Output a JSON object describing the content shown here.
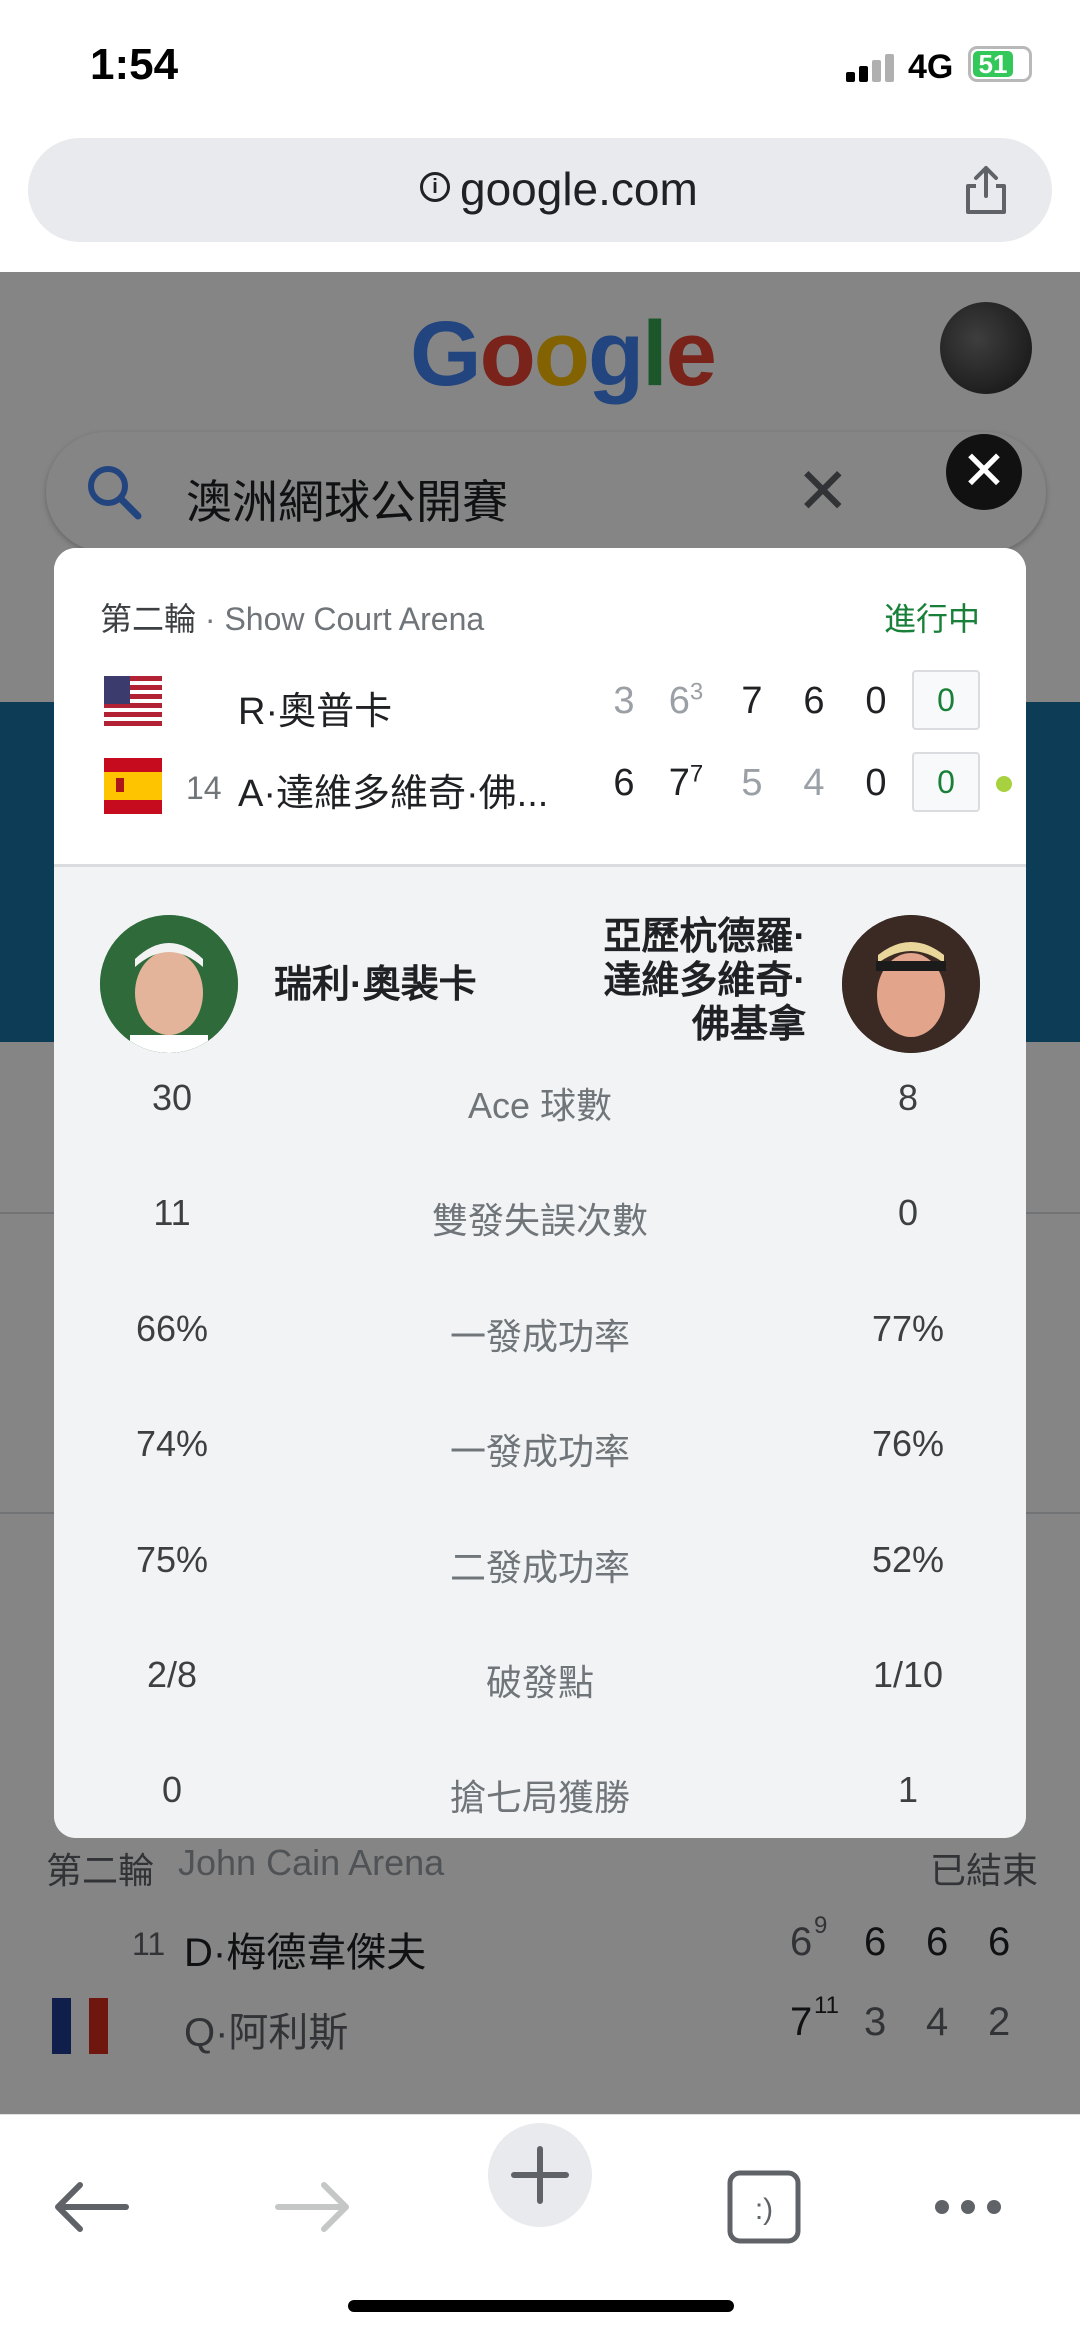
{
  "status_bar": {
    "time": "1:54",
    "network": "4G",
    "battery": "51"
  },
  "browser": {
    "url": "google.com"
  },
  "background_page": {
    "logo": "Google",
    "search_query": "澳洲網球公開賽",
    "bg_match": {
      "round": "第二輪",
      "venue": "John Cain Arena",
      "status": "已結束",
      "p1_seed": "11",
      "p1_name": "D·梅德韋傑夫",
      "p1_scores": [
        "6",
        "6",
        "6",
        "6"
      ],
      "p1_tb": "9",
      "p2_name": "Q·阿利斯",
      "p2_scores": [
        "7",
        "3",
        "4",
        "2"
      ],
      "p2_tb": "11"
    }
  },
  "dialog": {
    "round": "第二輪",
    "venue": "Show Court Arena",
    "status": "進行中",
    "players": [
      {
        "seed": "",
        "name": "R·奧普卡",
        "flag": "us-flag",
        "sets": [
          "3",
          "6",
          "7",
          "6",
          "0"
        ],
        "tiebreaks": [
          "",
          "3",
          "",
          "",
          ""
        ],
        "points": "0"
      },
      {
        "seed": "14",
        "name": "A·達維多維奇·佛...",
        "flag": "spain-flag",
        "sets": [
          "6",
          "7",
          "5",
          "4",
          "0"
        ],
        "tiebreaks": [
          "",
          "7",
          "",
          "",
          ""
        ],
        "points": "0"
      }
    ],
    "player1_full": "瑞利·奧裴卡",
    "player2_full_lines": [
      "亞歷杭德羅·",
      "達維多維奇·",
      "佛基拿"
    ],
    "stats": [
      {
        "left": "30",
        "label": "Ace 球數",
        "right": "8"
      },
      {
        "left": "11",
        "label": "雙發失誤次數",
        "right": "0"
      },
      {
        "left": "66%",
        "label": "一發成功率",
        "right": "77%"
      },
      {
        "left": "74%",
        "label": "一發成功率",
        "right": "76%"
      },
      {
        "left": "75%",
        "label": "二發成功率",
        "right": "52%"
      },
      {
        "left": "2/8",
        "label": "破發點",
        "right": "1/10"
      },
      {
        "left": "0",
        "label": "搶七局獲勝",
        "right": "1"
      }
    ]
  },
  "colors": {
    "live_green": "#188038",
    "serve_dot": "#a8d13f"
  }
}
